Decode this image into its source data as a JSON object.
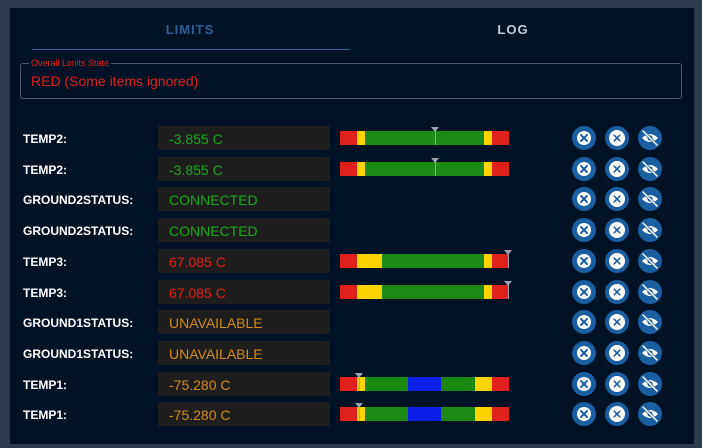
{
  "tabs": [
    {
      "label": "LIMITS",
      "active": true
    },
    {
      "label": "LOG",
      "active": false
    }
  ],
  "overall_state": {
    "label": "Overall Limits State",
    "value": "RED (Some items ignored)",
    "color": "#e0201a"
  },
  "colors": {
    "red": "#e0201a",
    "yellow": "#ffd300",
    "green": "#1a8a12",
    "blue": "#0b1fe8",
    "orange": "#d38a14",
    "button_blue": "#1b5fa0"
  },
  "rows": [
    {
      "label": "TEMP2:",
      "value": "-3.855 C",
      "color": "#19a619",
      "bar": "temp2",
      "position": 0.565
    },
    {
      "label": "TEMP2:",
      "value": "-3.855 C",
      "color": "#19a619",
      "bar": "temp2",
      "position": 0.565
    },
    {
      "label": "GROUND2STATUS:",
      "value": "CONNECTED",
      "color": "#19a619"
    },
    {
      "label": "GROUND2STATUS:",
      "value": "CONNECTED",
      "color": "#19a619"
    },
    {
      "label": "TEMP3:",
      "value": "67.085 C",
      "color": "#e0201a",
      "bar": "temp3",
      "position": 1.0
    },
    {
      "label": "TEMP3:",
      "value": "67.085 C",
      "color": "#e0201a",
      "bar": "temp3",
      "position": 1.0
    },
    {
      "label": "GROUND1STATUS:",
      "value": "UNAVAILABLE",
      "color": "#d38a14"
    },
    {
      "label": "GROUND1STATUS:",
      "value": "UNAVAILABLE",
      "color": "#d38a14"
    },
    {
      "label": "TEMP1:",
      "value": "-75.280 C",
      "color": "#d38a14",
      "bar": "temp1",
      "position": 0.115
    },
    {
      "label": "TEMP1:",
      "value": "-75.280 C",
      "color": "#d38a14",
      "bar": "temp1",
      "position": 0.115
    }
  ],
  "row_actions": [
    {
      "name": "ignore-item",
      "icon": "circle-x-icon"
    },
    {
      "name": "clear-item",
      "icon": "x-icon"
    },
    {
      "name": "hide-item",
      "icon": "eye-off-icon"
    }
  ]
}
